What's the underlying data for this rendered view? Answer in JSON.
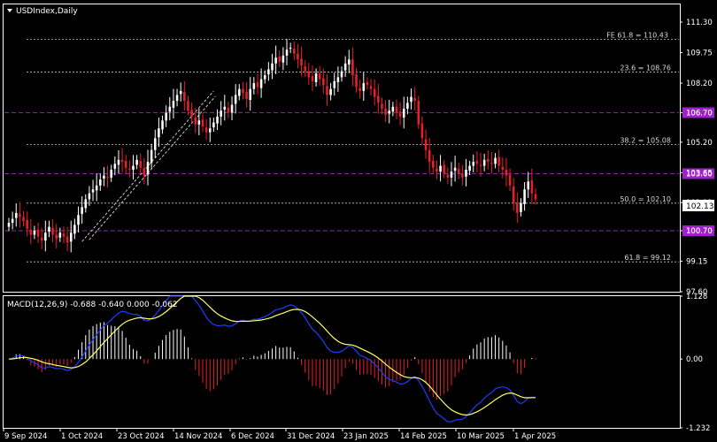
{
  "header": {
    "symbol_label": "USDIndex,Daily"
  },
  "macd_header": {
    "label": "MACD(12,26,9) -0.688 -0.640 0.000 -0.062"
  },
  "colors": {
    "background": "#000000",
    "border": "#ffffff",
    "bull_candle": "#ffffff",
    "bear_candle": "#e8202a",
    "level_line": "#8b2aa3",
    "level_tag": "#a21fd0",
    "fib_line": "#c8c8c8",
    "macd_line": "#1e3cff",
    "signal_line": "#ffff66",
    "hist_pos": "#ffffff",
    "hist_neg": "#e8202a"
  },
  "chart_data": [
    {
      "type": "candlestick",
      "title": "USDIndex,Daily",
      "ylim": [
        97.6,
        112.2
      ],
      "y_ticks": [
        "111.30",
        "109.75",
        "108.20",
        "106.70",
        "105.20",
        "103.65",
        "102.13",
        "100.70",
        "99.15",
        "97.60"
      ],
      "x_ticks": [
        "9 Sep 2024",
        "1 Oct 2024",
        "23 Oct 2024",
        "14 Nov 2024",
        "6 Dec 2024",
        "31 Dec 2024",
        "23 Jan 2025",
        "14 Feb 2025",
        "10 Mar 2025",
        "1 Apr 2025"
      ],
      "current_price": "102.13",
      "horizontal_levels": [
        {
          "label": "106.70",
          "value": 106.7
        },
        {
          "label": "103.60",
          "value": 103.6
        },
        {
          "label": "100.70",
          "value": 100.7
        }
      ],
      "fibonacci_levels": [
        {
          "label": "FE 61.8 = 110.43",
          "value": 110.43
        },
        {
          "label": "23.6 = 108.76",
          "value": 108.76
        },
        {
          "label": "38.2 = 105.08",
          "value": 105.08
        },
        {
          "label": "50.0 = 102.10",
          "value": 102.1
        },
        {
          "label": "61.8 = 99.12",
          "value": 99.12
        }
      ],
      "trendline": {
        "from": [
          "30 Sep 2024",
          100.15
        ],
        "to": [
          "20 Nov 2024",
          107.8
        ]
      },
      "closes": [
        101.1,
        101.3,
        101.6,
        101.4,
        101.2,
        100.8,
        100.5,
        100.7,
        100.4,
        100.2,
        100.6,
        100.9,
        100.5,
        100.3,
        100.6,
        100.4,
        100.1,
        100.6,
        101.0,
        101.5,
        101.9,
        102.3,
        102.6,
        102.8,
        103.0,
        103.3,
        103.5,
        103.4,
        103.8,
        104.1,
        104.3,
        104.2,
        103.9,
        103.8,
        104.0,
        104.3,
        103.9,
        103.5,
        104.2,
        104.8,
        105.4,
        105.9,
        106.3,
        106.7,
        107.0,
        107.3,
        107.6,
        107.8,
        107.3,
        106.8,
        106.5,
        106.1,
        106.3,
        106.0,
        105.7,
        105.9,
        106.2,
        106.5,
        106.8,
        107.0,
        106.7,
        107.1,
        107.6,
        107.9,
        107.7,
        107.4,
        107.9,
        108.2,
        108.0,
        108.4,
        108.6,
        108.9,
        109.2,
        109.5,
        109.3,
        109.6,
        109.9,
        110.0,
        109.7,
        109.4,
        109.1,
        108.8,
        108.5,
        108.3,
        108.7,
        108.4,
        108.1,
        107.6,
        107.9,
        108.3,
        108.5,
        108.8,
        109.2,
        109.4,
        108.6,
        108.0,
        107.8,
        108.2,
        108.1,
        107.9,
        107.5,
        107.2,
        106.9,
        106.6,
        106.8,
        107.0,
        106.7,
        106.5,
        106.9,
        107.2,
        107.5,
        107.3,
        106.1,
        105.4,
        104.8,
        104.2,
        103.9,
        103.7,
        104.0,
        103.6,
        103.4,
        103.7,
        103.9,
        103.6,
        103.4,
        103.8,
        104.0,
        104.2,
        104.1,
        104.0,
        104.3,
        104.2,
        104.1,
        104.4,
        104.0,
        103.8,
        103.5,
        103.0,
        102.1,
        101.6,
        102.1,
        102.8,
        103.2,
        102.6,
        102.3
      ]
    },
    {
      "type": "macd",
      "title": "MACD(12,26,9) -0.688 -0.640 0.000 -0.062",
      "ylim": [
        -1.232,
        1.128
      ],
      "y_ticks": [
        "1.128",
        "0.00",
        "-1.232"
      ],
      "macd": -0.688,
      "signal": -0.64,
      "histogram": -0.062
    }
  ]
}
